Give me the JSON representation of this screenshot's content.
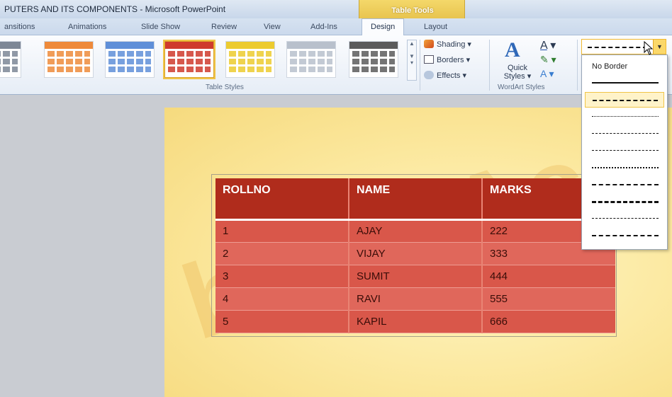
{
  "window": {
    "title": "PUTERS AND ITS COMPONENTS - Microsoft PowerPoint",
    "contextual_tab_group": "Table Tools"
  },
  "tabs": [
    {
      "label": "ansitions"
    },
    {
      "label": "Animations"
    },
    {
      "label": "Slide Show"
    },
    {
      "label": "Review"
    },
    {
      "label": "View"
    },
    {
      "label": "Add-Ins"
    },
    {
      "label": "Design"
    },
    {
      "label": "Layout"
    }
  ],
  "ribbon": {
    "table_styles_label": "Table Styles",
    "shading_label": "Shading",
    "borders_label": "Borders",
    "effects_label": "Effects",
    "quick_styles_label": "Quick Styles",
    "quick_label": "Quick",
    "styles_label": "Styles",
    "wordart_styles_label": "WordArt Styles",
    "style_colors": [
      "#7d8796",
      "#ee8a3a",
      "#5f8fd8",
      "#cf3a2c",
      "#eccb2f",
      "#b8c0cc",
      "#5b5b5b"
    ],
    "selected_style_index": 3
  },
  "border_dropdown": {
    "no_border_label": "No Border",
    "items": [
      {
        "style": "solid"
      },
      {
        "style": "dashed"
      },
      {
        "style": "dotted"
      },
      {
        "style": "dash-dot"
      },
      {
        "style": "dash-dot-dot"
      },
      {
        "style": "sparse-dot"
      },
      {
        "style": "long-dash"
      },
      {
        "style": "long-dash-thick"
      },
      {
        "style": "dash-dot-sparse"
      },
      {
        "style": "long-dash-dot"
      }
    ],
    "hovered_index": 1
  },
  "table": {
    "headers": [
      "ROLLNO",
      "NAME",
      "MARKS"
    ],
    "rows": [
      [
        "1",
        "AJAY",
        "222"
      ],
      [
        "2",
        "VIJAY",
        "333"
      ],
      [
        "3",
        "SUMIT",
        "444"
      ],
      [
        "4",
        "RAVI",
        "555"
      ],
      [
        "5",
        "KAPIL",
        "666"
      ]
    ]
  },
  "colors": {
    "header_fill": "#b02c1c",
    "row_fill": "#d9574a",
    "slide_bg": "#fbe79c",
    "accent": "#f0c447"
  }
}
